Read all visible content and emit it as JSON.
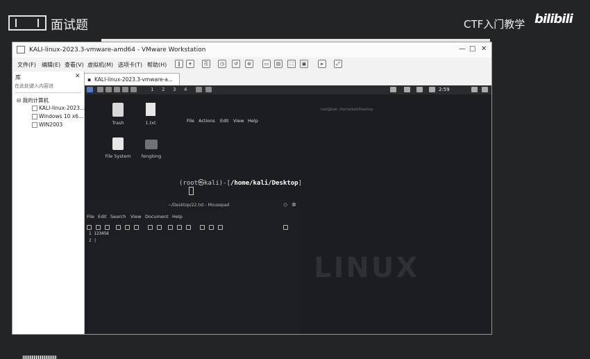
{
  "overlay": {
    "title": "面试题",
    "brand_text": "CTF入门教学",
    "brand_logo": "bilibili"
  },
  "vmware": {
    "window_title": "KALI-linux-2023.3-vmware-amd64 - VMware Workstation",
    "window_buttons": {
      "minimize": "—",
      "maximize": "□",
      "close": "✕"
    },
    "menu": [
      "文件(F)",
      "编辑(E)",
      "查看(V)",
      "虚拟机(M)",
      "选项卡(T)",
      "帮助(H)"
    ],
    "library": {
      "label": "库",
      "close": "✕",
      "search_placeholder": "在此处键入内容进",
      "root": "我的计算机",
      "items": [
        "KALI-linux-2023...",
        "Windows 10 x6...",
        "WIN2003"
      ]
    },
    "tab": {
      "label": "KALI-linux-2023.3-vmware-a..."
    }
  },
  "kali": {
    "workspaces": [
      "1",
      "2",
      "3",
      "4"
    ],
    "clock": "2:59",
    "desktop_icons": [
      {
        "label": "Trash",
        "icon": "trash-icon"
      },
      {
        "label": "1.txt",
        "icon": "file-icon"
      },
      {
        "label": "File System",
        "icon": "drive-icon"
      },
      {
        "label": "fenglong",
        "icon": "folder-icon"
      }
    ],
    "terminal": {
      "title": "root@kali: /home/kali/Desktop",
      "menu": [
        "File",
        "Actions",
        "Edit",
        "View",
        "Help"
      ],
      "prompt_user": "(root㉿kali)-[",
      "prompt_path": "/home/kali/Desktop",
      "prompt_end": "]",
      "prompt_symbol": "#"
    },
    "mousepad": {
      "title": "~/Desktop/22.txt - Mousepad",
      "menu": [
        "File",
        "Edit",
        "Search",
        "View",
        "Document",
        "Help"
      ],
      "lines": [
        "1 123456",
        "2 |"
      ]
    },
    "watermark": "LINUX"
  }
}
